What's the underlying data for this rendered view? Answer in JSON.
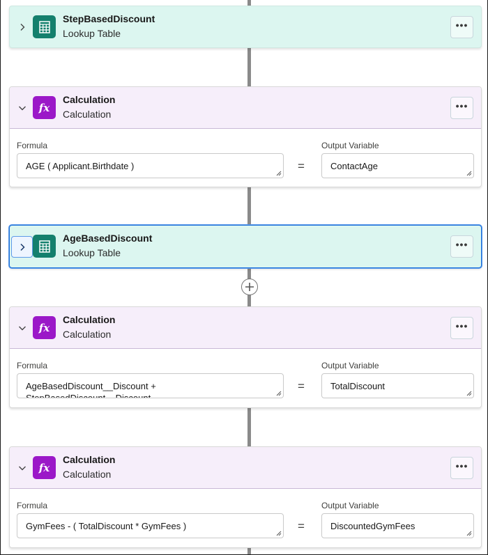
{
  "cards": [
    {
      "type": "lookup",
      "title": "StepBasedDiscount",
      "subtitle": "Lookup Table",
      "icon": "table-icon"
    },
    {
      "type": "calculation",
      "title": "Calculation",
      "subtitle": "Calculation",
      "icon": "fx-icon",
      "formula_label": "Formula",
      "formula": "AGE ( Applicant.Birthdate )",
      "output_label": "Output Variable",
      "output": "ContactAge",
      "equals": "="
    },
    {
      "type": "lookup",
      "title": "AgeBasedDiscount",
      "subtitle": "Lookup Table",
      "icon": "table-icon",
      "selected": true
    },
    {
      "type": "calculation",
      "title": "Calculation",
      "subtitle": "Calculation",
      "icon": "fx-icon",
      "formula_label": "Formula",
      "formula": "AgeBasedDiscount__Discount +\nStepBasedDiscount__Discount",
      "output_label": "Output Variable",
      "output": "TotalDiscount",
      "equals": "="
    },
    {
      "type": "calculation",
      "title": "Calculation",
      "subtitle": "Calculation",
      "icon": "fx-icon",
      "formula_label": "Formula",
      "formula": "GymFees - ( TotalDiscount * GymFees )",
      "output_label": "Output Variable",
      "output": "DiscountedGymFees",
      "equals": "="
    }
  ],
  "icons": {
    "fx_glyph": "fx",
    "menu_glyph": "•••"
  },
  "colors": {
    "lookup_bg": "#dcf6f0",
    "calc_header_bg": "#f6eefa",
    "table_icon": "#14806d",
    "fx_icon": "#9b18c8",
    "selected_border": "#1b6fdb"
  }
}
